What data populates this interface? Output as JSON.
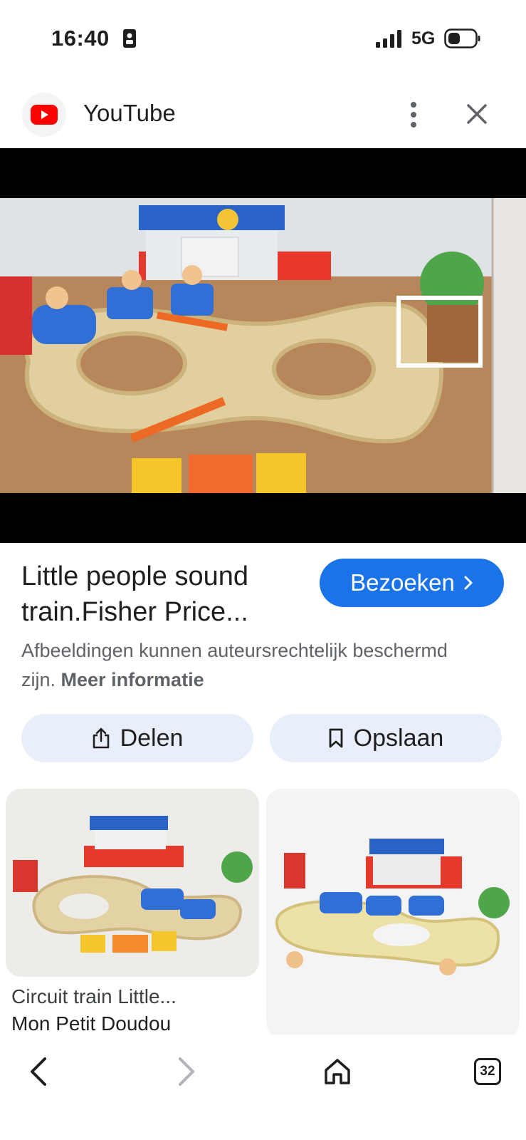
{
  "status": {
    "time": "16:40",
    "network": "5G",
    "icons": [
      "lock-screen-icon",
      "signal-icon",
      "battery-icon"
    ]
  },
  "header": {
    "site_name": "YouTube",
    "icons": [
      "youtube-logo-icon",
      "more-vert-icon",
      "close-icon"
    ]
  },
  "result": {
    "title": "Little people sound train.Fisher Price...",
    "visit_label": "Bezoeken",
    "copyright_notice": "Afbeeldingen kunnen auteursrechtelijk beschermd zijn.",
    "more_info_label": "Meer informatie"
  },
  "actions": {
    "share_label": "Delen",
    "save_label": "Opslaan"
  },
  "related": [
    {
      "title": "Circuit train Little...",
      "source": "Mon Petit Doudou"
    },
    {
      "title": "",
      "source": ""
    }
  ],
  "bottom_nav": {
    "tab_count": "32"
  },
  "colors": {
    "accent": "#1a73e8",
    "chip_bg": "#e8effb",
    "youtube_red": "#ff0000"
  }
}
